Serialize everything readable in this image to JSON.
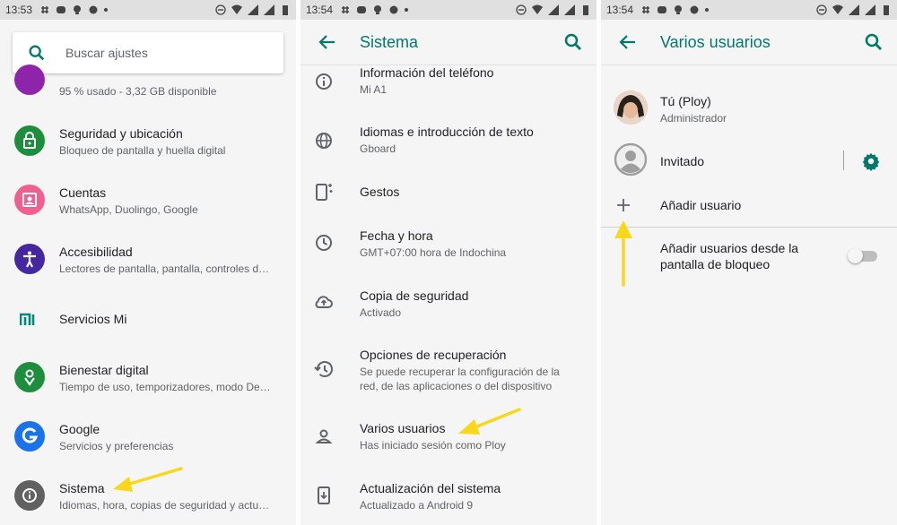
{
  "panel1": {
    "status": {
      "time": "13:53"
    },
    "search": {
      "placeholder": "Buscar ajustes"
    },
    "items": [
      {
        "title": "",
        "subtitle": "95 % usado - 3,32 GB disponible",
        "color": "#8e24aa",
        "icon": "storage-icon"
      },
      {
        "title": "Seguridad y ubicación",
        "subtitle": "Bloqueo de pantalla y huella digital",
        "color": "#1e8e3e",
        "icon": "lock-icon"
      },
      {
        "title": "Cuentas",
        "subtitle": "WhatsApp, Duolingo, Google",
        "color": "#ef6090",
        "icon": "account-box-icon"
      },
      {
        "title": "Accesibilidad",
        "subtitle": "Lectores de pantalla, pantalla, controles d…",
        "color": "#4527a0",
        "icon": "accessibility-icon"
      },
      {
        "title": "Servicios Mi",
        "subtitle": "",
        "color": "#00897b",
        "icon": "mi-logo-icon"
      },
      {
        "title": "Bienestar digital",
        "subtitle": "Tiempo de uso, temporizadores, modo De…",
        "color": "#1e8e3e",
        "icon": "wellbeing-icon"
      },
      {
        "title": "Google",
        "subtitle": "Servicios y preferencias",
        "color": "#1a73e8",
        "icon": "google-icon"
      },
      {
        "title": "Sistema",
        "subtitle": "Idiomas, hora, copias de seguridad y actu…",
        "color": "#616161",
        "icon": "info-icon"
      }
    ]
  },
  "panel2": {
    "status": {
      "time": "13:54"
    },
    "title": "Sistema",
    "items": [
      {
        "title": "Información del teléfono",
        "subtitle": "Mi A1",
        "icon": "info-outline-icon"
      },
      {
        "title": "Idiomas e introducción de texto",
        "subtitle": "Gboard",
        "icon": "globe-icon"
      },
      {
        "title": "Gestos",
        "subtitle": "",
        "icon": "gestures-phone-icon"
      },
      {
        "title": "Fecha y hora",
        "subtitle": "GMT+07:00 hora de Indochina",
        "icon": "clock-icon"
      },
      {
        "title": "Copia de seguridad",
        "subtitle": "Activado",
        "icon": "cloud-upload-icon"
      },
      {
        "title": "Opciones de recuperación",
        "subtitle": "Se puede recuperar la configuración de la",
        "subtitle2": "red, de las aplicaciones o del dispositivo",
        "icon": "restore-icon"
      },
      {
        "title": "Varios usuarios",
        "subtitle": "Has iniciado sesión como Ploy",
        "icon": "person-icon"
      },
      {
        "title": "Actualización del sistema",
        "subtitle": "Actualizado a Android 9",
        "icon": "system-update-icon"
      }
    ]
  },
  "panel3": {
    "status": {
      "time": "13:54"
    },
    "title": "Varios usuarios",
    "user": {
      "name": "Tú (Ploy)",
      "role": "Administrador"
    },
    "guest": {
      "name": "Invitado"
    },
    "add_user": "Añadir usuario",
    "lockscreen_line1": "Añadir usuarios desde la",
    "lockscreen_line2": "pantalla de bloqueo"
  },
  "colors": {
    "accent": "#00796b",
    "arrow": "#f9d71c"
  }
}
